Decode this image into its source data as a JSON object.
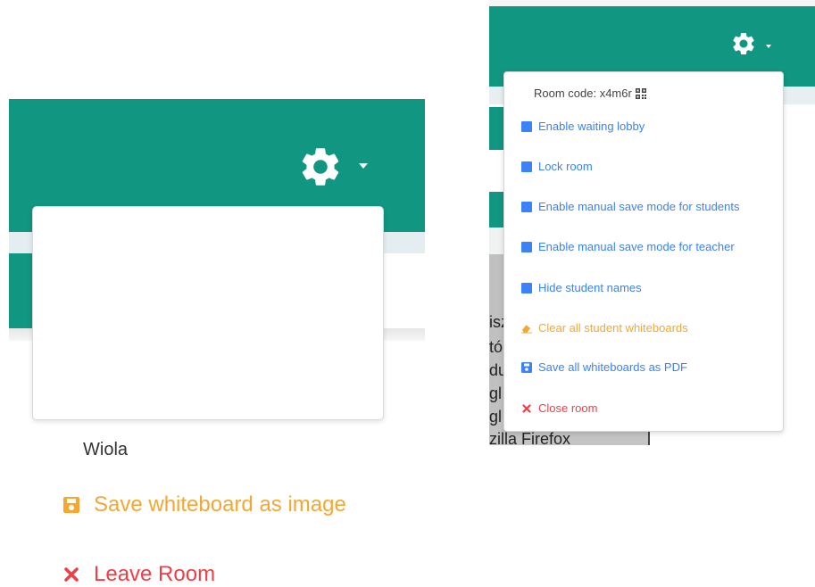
{
  "colors": {
    "teal": "#119682",
    "menu_blue": "#3b82f6",
    "orange": "#f4a733",
    "red": "#ef3e46"
  },
  "left_menu": {
    "user_name": "Wiola",
    "items": [
      {
        "label": "Save whiteboard as image",
        "icon": "save-icon"
      },
      {
        "label": "Leave Room",
        "icon": "close-icon"
      }
    ]
  },
  "right_menu": {
    "room_code": "Room code: x4m6r",
    "room_code_icon": "qr-code-icon",
    "items": [
      {
        "label": "Enable waiting lobby",
        "icon": "checkbox-icon"
      },
      {
        "label": "Lock room",
        "icon": "checkbox-icon"
      },
      {
        "label": "Enable manual save mode for students",
        "icon": "checkbox-icon"
      },
      {
        "label": "Enable manual save mode for teacher",
        "icon": "checkbox-icon"
      },
      {
        "label": "Hide student names",
        "icon": "checkbox-icon"
      },
      {
        "label": "Clear all student whiteboards",
        "icon": "eraser-icon"
      },
      {
        "label": "Save all whiteboards as PDF",
        "icon": "save-icon"
      },
      {
        "label": "Close room",
        "icon": "close-icon"
      }
    ]
  },
  "background_text": [
    "isz",
    "tó",
    "du",
    "gl",
    "gl",
    "zilla Firefox"
  ]
}
